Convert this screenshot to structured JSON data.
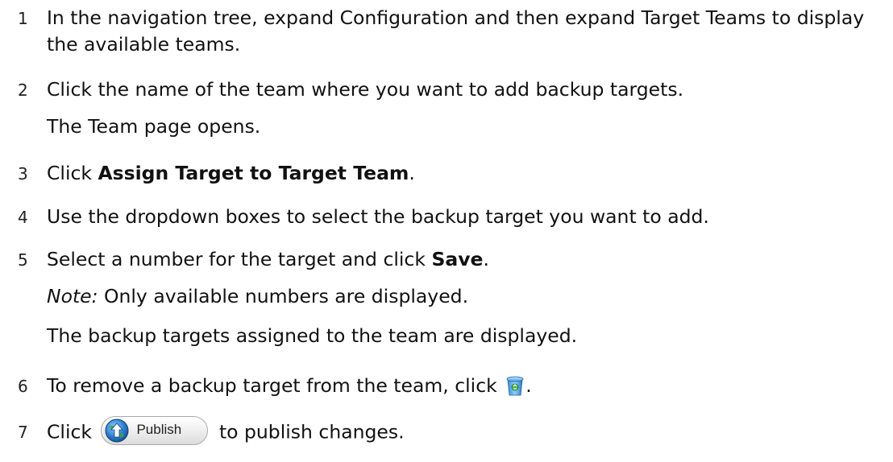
{
  "steps": [
    {
      "number": "1",
      "text": "In the navigation tree, expand Configuration and then expand Target Teams to display the available teams."
    },
    {
      "number": "2",
      "text": "Click the name of the team where you want to add backup targets.",
      "result": "The Team page opens."
    },
    {
      "number": "3",
      "prefix": "Click ",
      "bold": "Assign Target to Target Team",
      "suffix": "."
    },
    {
      "number": "4",
      "text": "Use the dropdown boxes to select the backup target you want to add."
    },
    {
      "number": "5",
      "prefix": "Select a number for the target and click ",
      "bold": "Save",
      "suffix": ".",
      "note_label": "Note:",
      "note_text": " Only available numbers are displayed.",
      "result": "The backup targets assigned to the team are displayed."
    },
    {
      "number": "6",
      "prefix": "To remove a backup target from the team, click ",
      "icon": "recycle-bin-icon",
      "suffix": "."
    },
    {
      "number": "7",
      "prefix": "Click ",
      "button_label": "Publish",
      "button_icon": "publish-globe-icon",
      "suffix": " to publish changes."
    }
  ]
}
